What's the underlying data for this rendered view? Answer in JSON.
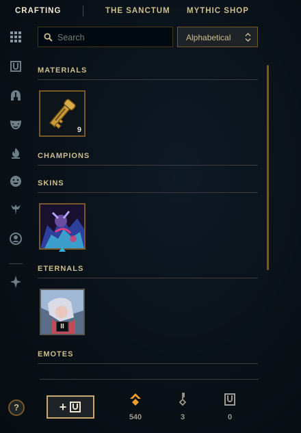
{
  "tabs": [
    {
      "label": "CRAFTING",
      "active": true
    },
    {
      "label": "THE SANCTUM",
      "active": false
    },
    {
      "label": "MYTHIC SHOP",
      "active": false
    }
  ],
  "sidebar": {
    "icons": [
      "grid-icon",
      "chest-icon",
      "helmet-icon",
      "mask-icon",
      "ward-icon",
      "emote-icon",
      "summoner-icon",
      "profile-icon",
      "companion-icon"
    ]
  },
  "search": {
    "placeholder": "Search",
    "value": ""
  },
  "sort": {
    "label": "Alphabetical"
  },
  "sections": {
    "materials": "MATERIALS",
    "champions": "CHAMPIONS",
    "skins": "SKINS",
    "eternals": "ETERNALS",
    "emotes": "EMOTES"
  },
  "items": {
    "key_fragment_count": "9",
    "eternal_tier": "II"
  },
  "footer": {
    "help": "?",
    "add_button": "+",
    "currencies": [
      {
        "icon": "orange-essence-icon",
        "value": "540"
      },
      {
        "icon": "key-icon",
        "value": "3"
      },
      {
        "icon": "chest-icon",
        "value": "0"
      }
    ]
  },
  "colors": {
    "gold": "#c8aa6e",
    "gold_dark": "#785a28",
    "text": "#cdbe91",
    "orange": "#f0a030"
  }
}
